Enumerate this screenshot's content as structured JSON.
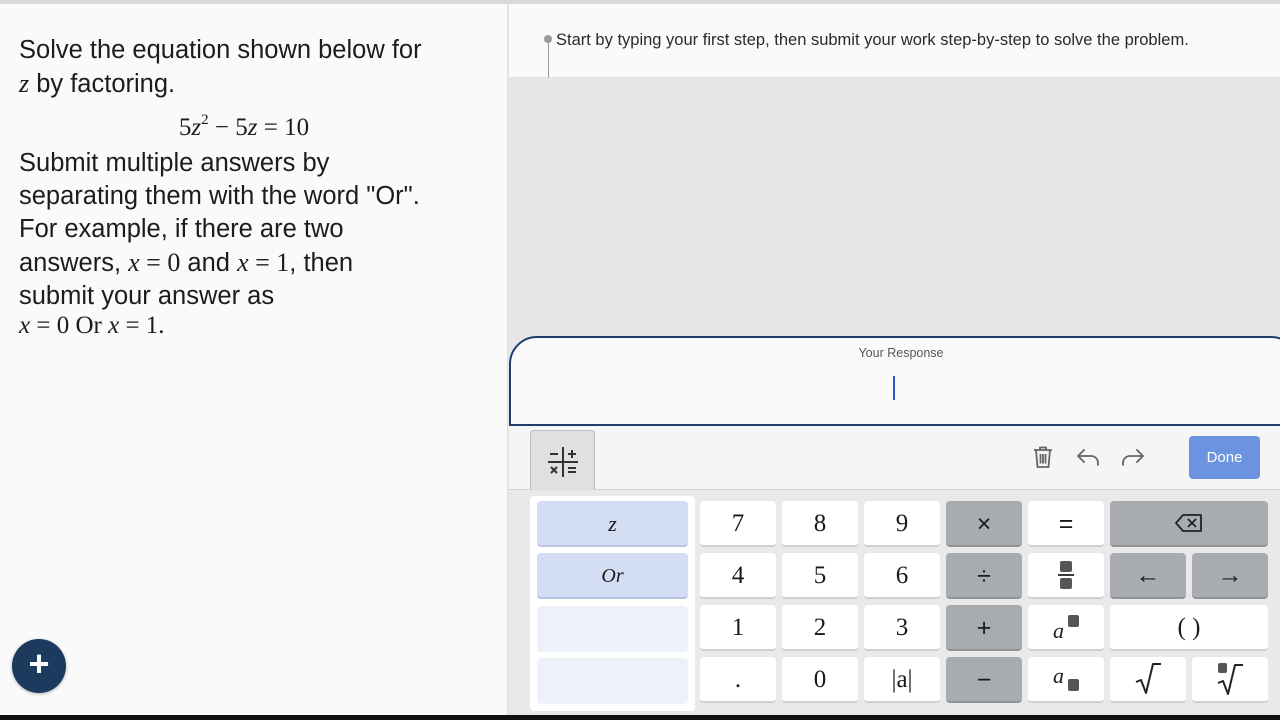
{
  "problem": {
    "line1": "Solve the equation shown below for",
    "var": "z",
    "line2_rest": " by factoring.",
    "eq": {
      "c1": "5",
      "v1": "z",
      "exp": "2",
      "mid": " − 5",
      "v2": "z",
      "end": " = 10"
    },
    "instr1": "Submit multiple answers by",
    "instr2": "separating them with the word \"Or\".",
    "instr3": "For example, if there are two",
    "instr4a": "answers, ",
    "instr4_x1": "x",
    "instr4_eq1": " = 0",
    "instr4_and": " and ",
    "instr4_x2": "x",
    "instr4_eq2": " = 1",
    "instr4b": ", then",
    "instr5": "submit your answer as",
    "ex_x1": "x",
    "ex_eq1": " = 0 Or ",
    "ex_x2": "x",
    "ex_eq2": " = 1."
  },
  "fab_label": "+",
  "hint": "Start by typing your first step, then submit your work step-by-step to solve the problem.",
  "response_label": "Your Response",
  "toolbar": {
    "done": "Done"
  },
  "variables": [
    {
      "label": "z",
      "active": true
    },
    {
      "label": "Or",
      "active": true
    },
    {
      "label": "",
      "active": false
    },
    {
      "label": "",
      "active": false
    }
  ],
  "keys": {
    "k7": "7",
    "k8": "8",
    "k9": "9",
    "times": "×",
    "equals": "=",
    "k4": "4",
    "k5": "5",
    "k6": "6",
    "divide": "÷",
    "left": "←",
    "right": "→",
    "k1": "1",
    "k2": "2",
    "k3": "3",
    "plus": "+",
    "parens": "( )",
    "dot": ".",
    "k0": "0",
    "abs": "|a|",
    "minus": "−"
  }
}
